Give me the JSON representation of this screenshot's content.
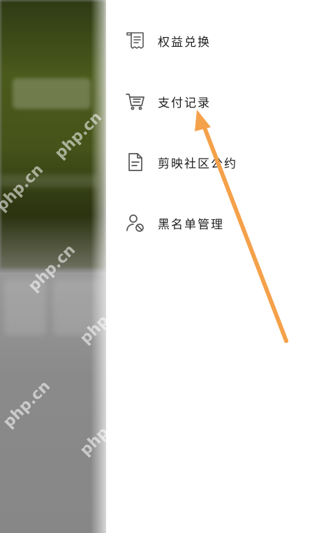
{
  "drawer": {
    "items": [
      {
        "label": "权益兑换",
        "icon": "receipt-icon"
      },
      {
        "label": "支付记录",
        "icon": "cart-icon"
      },
      {
        "label": "剪映社区公约",
        "icon": "document-icon"
      },
      {
        "label": "黑名单管理",
        "icon": "user-block-icon"
      }
    ]
  },
  "watermark": {
    "text": "php.cn"
  },
  "annotation": {
    "arrow_color": "#F5A14A"
  }
}
